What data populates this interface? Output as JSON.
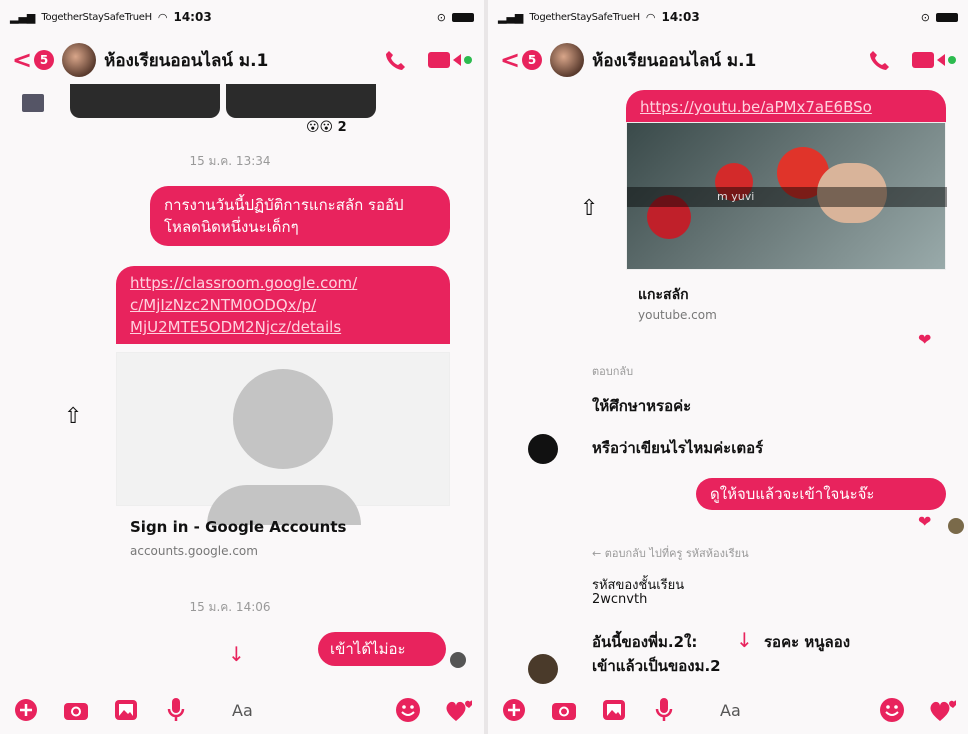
{
  "status": {
    "carrier": "TogetherStaySafeTrueH",
    "time": "14:03"
  },
  "chat": {
    "group_name": "ห้องเรียนออนไลน์ ม.1",
    "unread_count": "5"
  },
  "left": {
    "reaction_count": "2",
    "ts1": "15 ม.ค. 13:34",
    "msg1": "การงานวันนี้ปฏิบัติการแกะสลัก รออัปโหลดนิดหนึ่งนะเด็กๆ",
    "link_lines": [
      "https://classroom.google.com/",
      "c/MjIzNzc2NTM0ODQx/p/",
      "MjU2MTE5ODM2Njcz/details"
    ],
    "preview_title": "Sign in - Google Accounts",
    "preview_domain": "accounts.google.com",
    "ts2": "15 ม.ค. 14:06",
    "msg2": "เข้าได้ไม่อะ"
  },
  "right": {
    "link": "https://youtu.be/aPMx7aE6BSo",
    "video_overlay": "m  yuvi",
    "preview_title": "แกะสลัก",
    "preview_domain": "youtube.com",
    "reply_label": "ตอบกลับ",
    "msg_a": "ให้ศึกษาหรอค่ะ",
    "msg_b": "หรือว่าเขียนไรไหมค่ะเตอร์",
    "msg_mine": "ดูให้จบแล้วจะเข้าใจนะจ๊ะ",
    "reply_note": "← ตอบกลับ ไปที่ครู รหัสห้องเรียน",
    "code_label": "รหัสของชั้นเรียน",
    "code_value": "2wcnvth",
    "msg_c_line1": "อันนี้ของพี่ม.2ใ:",
    "msg_c_mid": "รอคะ หนูลอง",
    "msg_c_line2": "เข้าแล้วเป็นของม.2"
  },
  "composer": {
    "placeholder": "Aa"
  },
  "colors": {
    "accent": "#e8235d",
    "online": "#2dbb4f"
  }
}
